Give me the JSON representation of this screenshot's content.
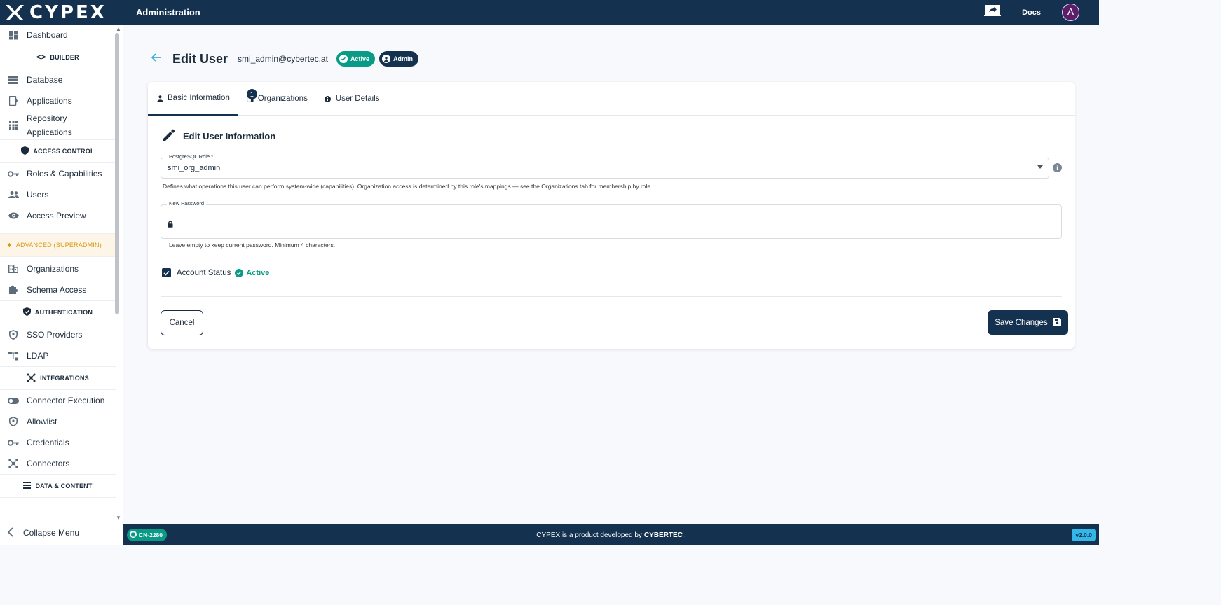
{
  "topbar": {
    "brand": "CYPEX",
    "section": "Administration",
    "docs": "Docs",
    "avatar_initial": "A"
  },
  "sidebar": {
    "items": {
      "dashboard": "Dashboard",
      "builder": "BUILDER",
      "database": "Database",
      "applications": "Applications",
      "repo_line1": "Repository",
      "repo_line2": "Applications",
      "access_control": "ACCESS CONTROL",
      "roles": "Roles & Capabilities",
      "users": "Users",
      "access_preview": "Access Preview",
      "advanced": "ADVANCED (SUPERADMIN)",
      "organizations": "Organizations",
      "schema_access": "Schema Access",
      "authentication": "AUTHENTICATION",
      "sso": "SSO Providers",
      "ldap": "LDAP",
      "integrations": "INTEGRATIONS",
      "connector_execution": "Connector Execution",
      "allowlist": "Allowlist",
      "credentials": "Credentials",
      "connectors": "Connectors",
      "data_content": "DATA & CONTENT"
    },
    "collapse": "Collapse Menu"
  },
  "page": {
    "title": "Edit User",
    "email": "smi_admin@cybertec.at",
    "badge_active": "Active",
    "badge_admin": "Admin"
  },
  "tabs": {
    "basic": "Basic Information",
    "organizations": "Organizations",
    "organizations_count": "1",
    "details": "User Details"
  },
  "form": {
    "title": "Edit User Information",
    "role_label": "PostgreSQL Role *",
    "role_value": "smi_org_admin",
    "role_help": "Defines what operations this user can perform system-wide (capabilities). Organization access is determined by this role's mappings — see the Organizations tab for membership by role.",
    "password_label": "New Password",
    "password_help": "Leave empty to keep current password. Minimum 4 characters.",
    "status_label": "Account Status",
    "status_value": "Active",
    "cancel": "Cancel",
    "save": "Save Changes"
  },
  "footer": {
    "build": "CN-2280",
    "text_before": "CYPEX is a product developed by",
    "link": "CYBERTEC",
    "text_after": ".",
    "version": "v2.0.0"
  },
  "colors": {
    "primary": "#14314f",
    "success": "#0a9b87",
    "accent": "#33b7e8",
    "warning": "#d89a10"
  }
}
